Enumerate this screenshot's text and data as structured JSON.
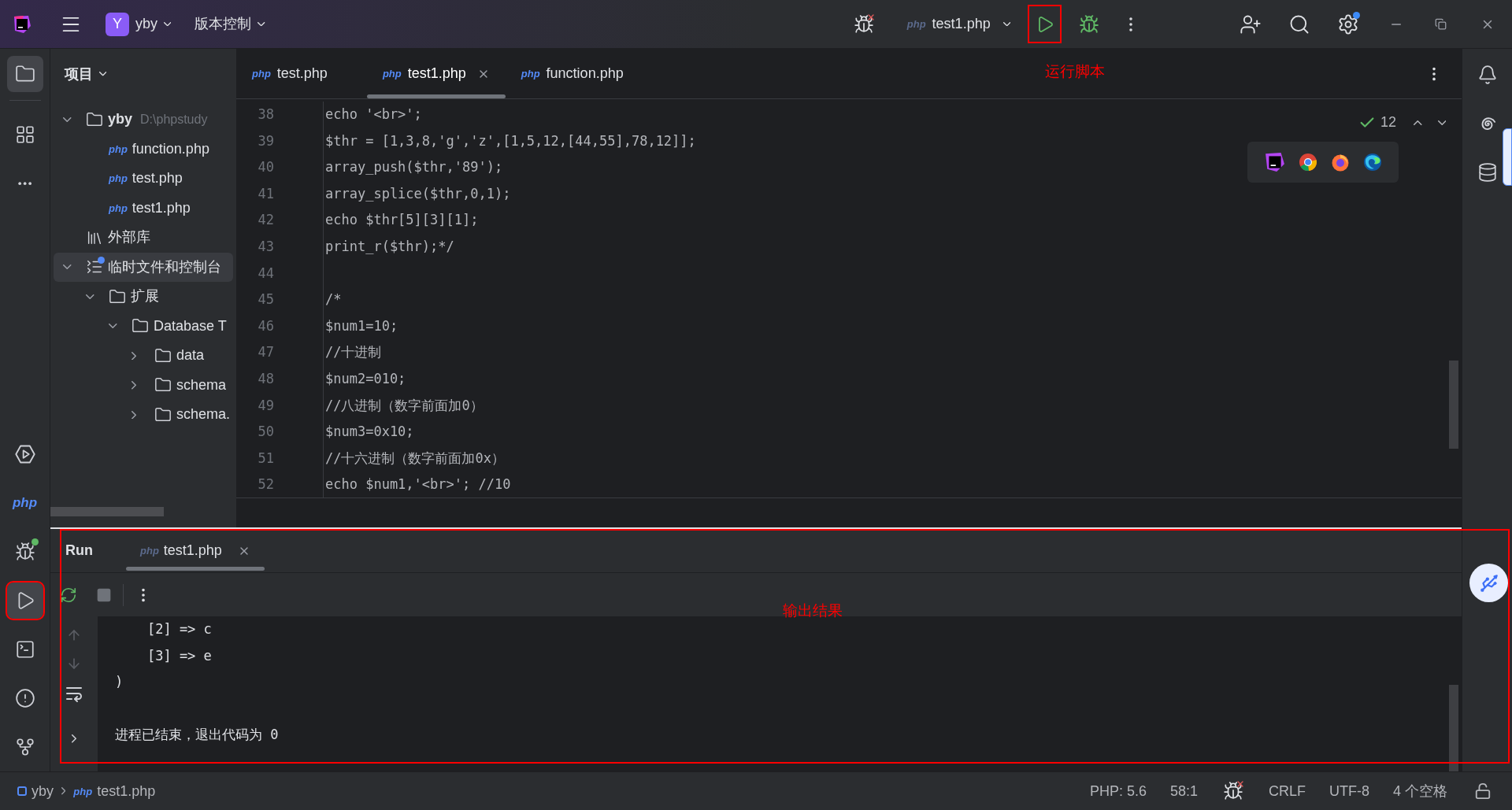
{
  "title_bar": {
    "project_avatar": "Y",
    "project": "yby",
    "vcs": "版本控制",
    "run_config": {
      "badge": "php",
      "label": "test1.php"
    }
  },
  "left_toolbar": {
    "top": [
      {
        "kind": "project",
        "selected": true
      },
      {
        "kind": "structure",
        "selected": false
      },
      {
        "kind": "more",
        "selected": false
      }
    ],
    "bottom": [
      {
        "kind": "services",
        "selected": false,
        "running": false
      },
      {
        "kind": "php",
        "label": "php",
        "selected": false,
        "running": false
      },
      {
        "kind": "debug",
        "selected": false,
        "running": true
      },
      {
        "kind": "run",
        "selected": true,
        "running": false
      },
      {
        "kind": "terminal",
        "selected": false,
        "running": false
      },
      {
        "kind": "problems",
        "selected": false,
        "running": false
      },
      {
        "kind": "git",
        "selected": false,
        "running": false
      }
    ]
  },
  "project_panel": {
    "title": "项目",
    "tree": [
      {
        "kind": "project",
        "label": "yby",
        "detail": "D:\\phpstudy",
        "expanded": true,
        "selected": false,
        "children": [
          {
            "kind": "file",
            "badge": "php",
            "label": "function.php",
            "selected": false
          },
          {
            "kind": "file",
            "badge": "php",
            "label": "test.php",
            "selected": false
          },
          {
            "kind": "file",
            "badge": "php",
            "label": "test1.php",
            "selected": false
          }
        ]
      },
      {
        "kind": "library",
        "label": "外部库",
        "selected": false
      },
      {
        "kind": "scratches",
        "label": "临时文件和控制台",
        "expanded": true,
        "selected": true,
        "children": [
          {
            "kind": "folder",
            "label": "扩展",
            "expanded": true,
            "selected": false,
            "children": [
              {
                "kind": "folder",
                "label": "Database T",
                "expanded": true,
                "selected": false,
                "children": [
                  {
                    "kind": "folder",
                    "label": "data",
                    "expanded": false,
                    "selected": false
                  },
                  {
                    "kind": "folder",
                    "label": "schema",
                    "expanded": false,
                    "selected": false
                  },
                  {
                    "kind": "folder",
                    "label": "schema.",
                    "expanded": false,
                    "selected": false
                  }
                ]
              }
            ]
          }
        ]
      }
    ]
  },
  "editor": {
    "tabs": [
      {
        "badge": "php",
        "label": "test.php",
        "selected": false
      },
      {
        "badge": "php",
        "label": "test1.php",
        "selected": true
      },
      {
        "badge": "php",
        "label": "function.php",
        "selected": false
      }
    ],
    "inspections": "12",
    "lines": [
      {
        "n": "38",
        "code": "echo '<br>';"
      },
      {
        "n": "39",
        "code": "$thr = [1,3,8,'g','z',[1,5,12,[44,55],78,12]];"
      },
      {
        "n": "40",
        "code": "array_push($thr,'89');"
      },
      {
        "n": "41",
        "code": "array_splice($thr,0,1);"
      },
      {
        "n": "42",
        "code": "echo $thr[5][3][1];"
      },
      {
        "n": "43",
        "code": "print_r($thr);*/"
      },
      {
        "n": "44"
      },
      {
        "n": "45",
        "code": "/*"
      },
      {
        "n": "46",
        "code": "$num1=10;"
      },
      {
        "n": "47",
        "code": "//十进制"
      },
      {
        "n": "48",
        "code": "$num2=010;"
      },
      {
        "n": "49",
        "code": "//八进制（数字前面加0）"
      },
      {
        "n": "50",
        "code": "$num3=0x10;"
      },
      {
        "n": "51",
        "code": "//十六进制（数字前面加0x）"
      },
      {
        "n": "52",
        "code": "echo $num1,'<br>'; //10"
      }
    ]
  },
  "run_panel": {
    "title": "Run",
    "tabs": [
      {
        "badge": "php",
        "label": "test1.php",
        "selected": true
      }
    ],
    "output": [
      {
        "kind": "line",
        "text": "    [2] => c"
      },
      {
        "kind": "line",
        "text": "    [3] => e"
      },
      {
        "kind": "line",
        "text": ")"
      },
      {
        "kind": "blank"
      },
      {
        "kind": "line",
        "text": "进程已结束，退出代码为 0"
      }
    ]
  },
  "status_bar": {
    "breadcrumbs": [
      {
        "kind": "module",
        "label": "yby"
      },
      {
        "kind": "file",
        "badge": "php",
        "label": "test1.php"
      }
    ],
    "items": [
      {
        "kind": "text",
        "label": "PHP: 5.6"
      },
      {
        "kind": "text",
        "label": "58:1"
      },
      {
        "kind": "debug"
      },
      {
        "kind": "text",
        "label": "CRLF"
      },
      {
        "kind": "text",
        "label": "UTF-8"
      },
      {
        "kind": "text",
        "label": "4 个空格"
      },
      {
        "kind": "lock"
      }
    ]
  },
  "annotations": {
    "run_label": "运行脚本",
    "output_label": "输出结果"
  }
}
